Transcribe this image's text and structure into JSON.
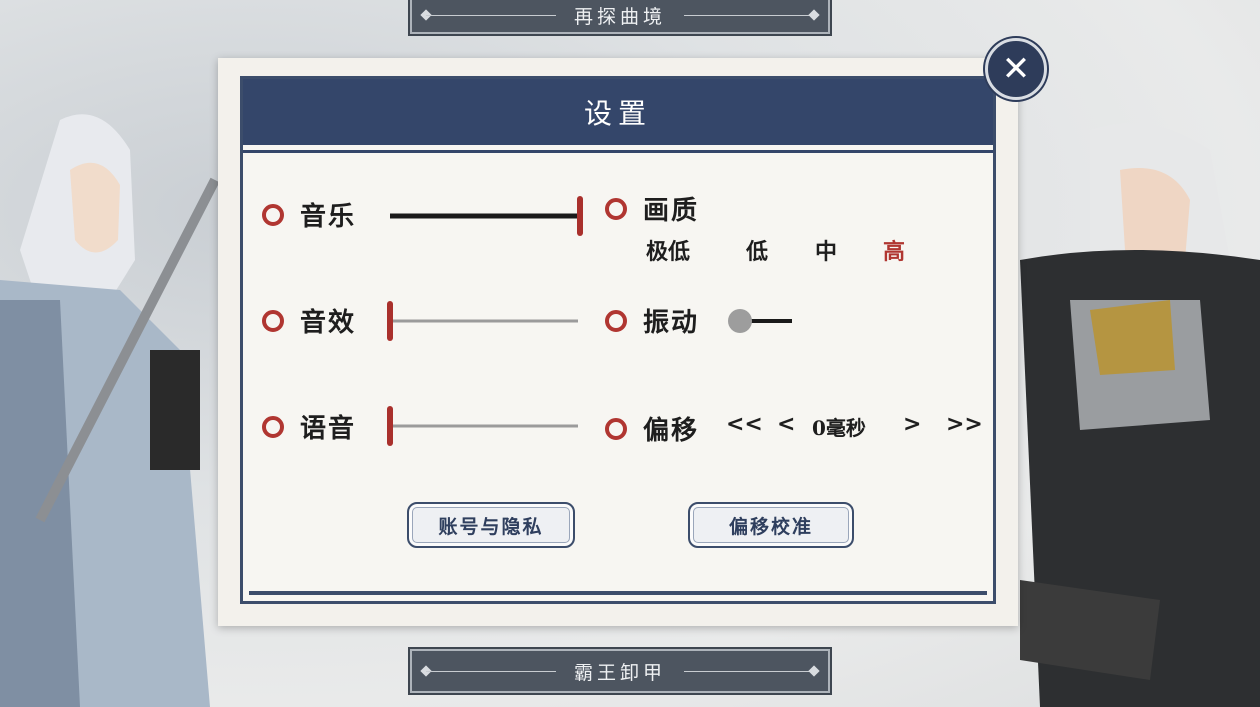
{
  "banners": {
    "top": "再探曲境",
    "bottom": "霸王卸甲"
  },
  "dialog": {
    "title": "设置",
    "close_icon": "close-x-icon"
  },
  "settings": {
    "music": {
      "label": "音乐",
      "value": 1.0
    },
    "sfx": {
      "label": "音效",
      "value": 0.0
    },
    "voice": {
      "label": "语音",
      "value": 0.0
    },
    "quality": {
      "label": "画质",
      "options": [
        "极低",
        "低",
        "中",
        "高"
      ],
      "selected": "高"
    },
    "vibration": {
      "label": "振动",
      "state": "off"
    },
    "offset": {
      "label": "偏移",
      "dec_fast": "<<",
      "dec": "<",
      "value": "0毫秒",
      "inc": ">",
      "inc_fast": ">>"
    }
  },
  "buttons": {
    "account": "账号与隐私",
    "calibrate": "偏移校准"
  },
  "colors": {
    "accent_red": "#b03631",
    "navy": "#34466a"
  }
}
